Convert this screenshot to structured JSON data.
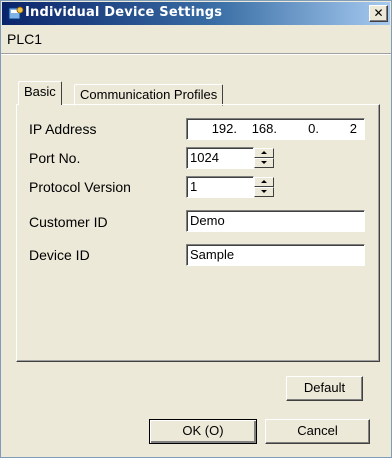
{
  "window": {
    "title": "Individual Device Settings",
    "close_glyph": "✕",
    "icon": "plc-settings-icon"
  },
  "device": {
    "name": "PLC1"
  },
  "tabs": [
    {
      "label": "Basic",
      "active": true
    },
    {
      "label": "Communication Profiles",
      "active": false
    }
  ],
  "basic": {
    "ip_label": "IP Address",
    "ip_octets": [
      "192.",
      "168.",
      "0.",
      "2"
    ],
    "port_label": "Port No.",
    "port_value": "1024",
    "protocol_label": "Protocol Version",
    "protocol_value": "1",
    "customer_label": "Customer ID",
    "customer_value": "Demo",
    "device_label": "Device ID",
    "device_value": "Sample"
  },
  "buttons": {
    "default": "Default",
    "ok": "OK (O)",
    "cancel": "Cancel"
  },
  "colors": {
    "title_start": "#0a246a",
    "title_end": "#a6caf0",
    "face": "#ece9d8"
  }
}
